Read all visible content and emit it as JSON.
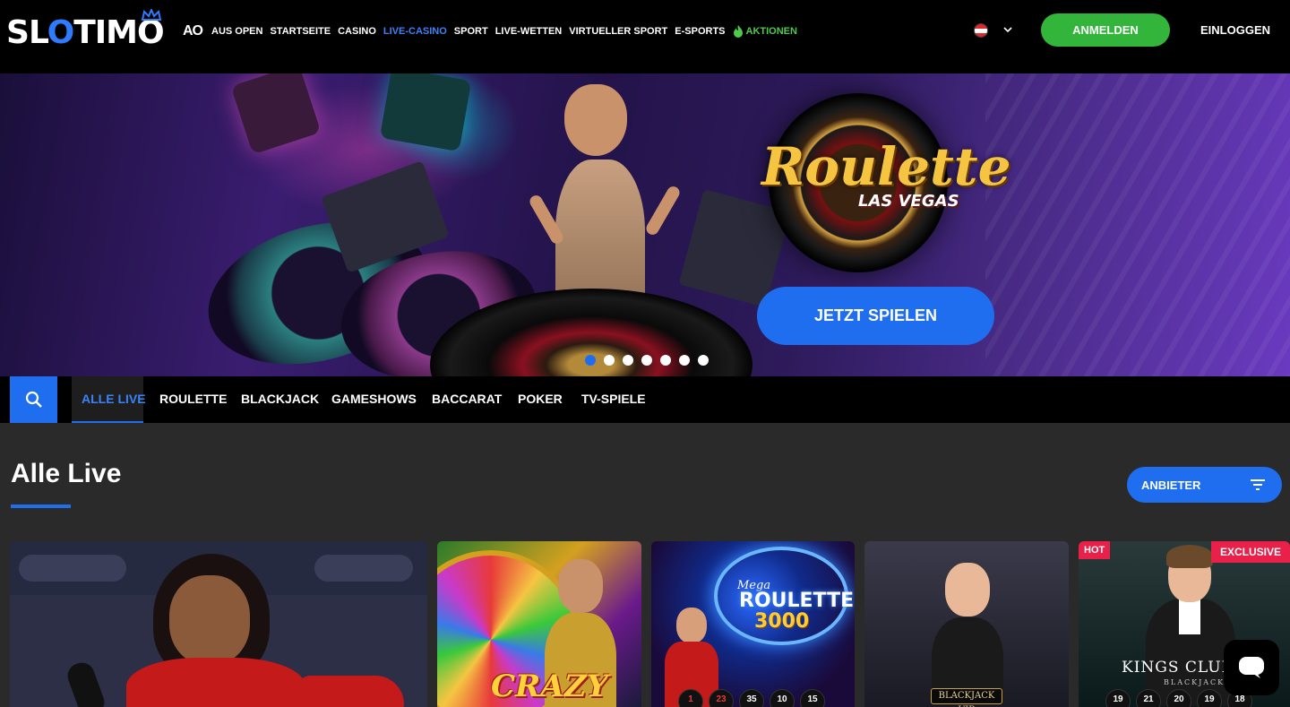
{
  "header": {
    "logo_text": "SLOTIMO",
    "nav": {
      "ao_logo": "AO",
      "items": [
        "AUS OPEN",
        "STARTSEITE",
        "CASINO",
        "LIVE-CASINO",
        "SPORT",
        "LIVE-WETTEN",
        "VIRTUELLER SPORT",
        "E-SPORTS",
        "AKTIONEN"
      ],
      "active_index": 3
    },
    "language_flag": "austria-flag",
    "register_label": "ANMELDEN",
    "login_label": "EINLOGGEN"
  },
  "banner": {
    "logo_title": "Roulette",
    "logo_subtitle": "LAS VEGAS",
    "cta_label": "JETZT SPIELEN",
    "slide_count": 7,
    "active_slide": 1
  },
  "categories": {
    "search_icon": "search-icon",
    "items": [
      "ALLE LIVE",
      "ROULETTE",
      "BLACKJACK",
      "GAMESHOWS",
      "BACCARAT",
      "POKER",
      "TV-SPIELE"
    ],
    "active_index": 0
  },
  "section": {
    "title": "Alle Live",
    "filter_label": "ANBIETER"
  },
  "games": [
    {
      "id": "aviator-live",
      "badges": []
    },
    {
      "id": "crazy-time",
      "title": "CRAZY",
      "badges": []
    },
    {
      "id": "mega-roulette-3000",
      "title_small": "Mega",
      "title_line1": "ROULETTE",
      "title_line2": "3000",
      "numbers": [
        "1",
        "23",
        "35",
        "10",
        "15"
      ],
      "red_numbers": [
        "1",
        "23"
      ],
      "badges": []
    },
    {
      "id": "blackjack-vip",
      "title": "BLACKJACK VIP",
      "badges": []
    },
    {
      "id": "kings-club-blackjack",
      "title": "KINGS CLUB",
      "subtitle": "BLACKJACK",
      "numbers": [
        "19",
        "21",
        "20",
        "19",
        "18"
      ],
      "badges": [
        "HOT",
        "EXCLUSIVE"
      ]
    }
  ],
  "colors": {
    "accent_blue": "#1f6ef0",
    "register_green": "#32b53a",
    "promo_green": "#4ec94e",
    "badge_red": "#e8204a"
  }
}
